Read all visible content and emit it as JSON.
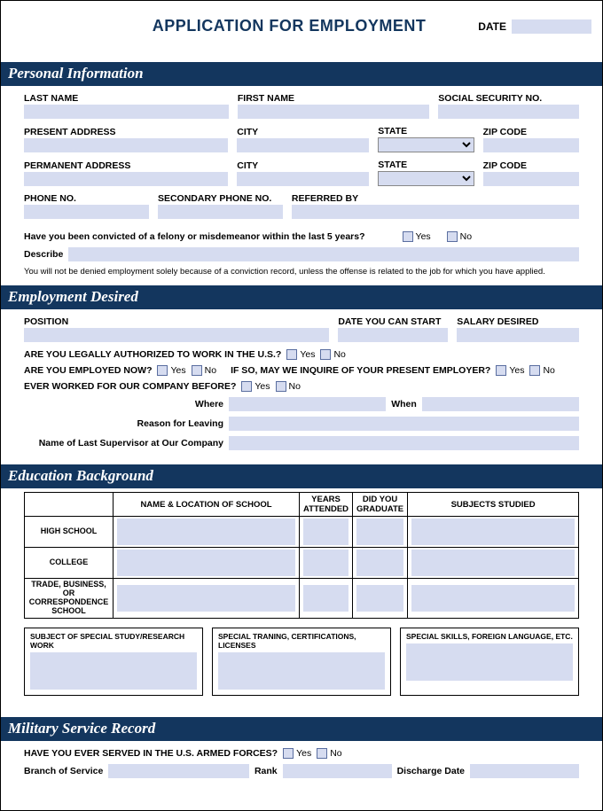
{
  "header": {
    "title": "APPLICATION FOR EMPLOYMENT",
    "date_label": "DATE"
  },
  "sections": {
    "personal": {
      "title": "Personal Information",
      "last_name": "LAST NAME",
      "first_name": "FIRST NAME",
      "ssn": "SOCIAL SECURITY NO.",
      "present_address": "PRESENT ADDRESS",
      "city": "CITY",
      "state": "STATE",
      "zip": "ZIP CODE",
      "permanent_address": "PERMANENT ADDRESS",
      "phone": "PHONE NO.",
      "secondary_phone": "SECONDARY PHONE NO.",
      "referred_by": "REFERRED BY",
      "felony_q": "Have you been convicted of a felony or misdemeanor within the last 5 years?",
      "yes": "Yes",
      "no": "No",
      "describe": "Describe",
      "disclaimer": "You will not be denied employment solely because of a conviction record, unless the offense is related to the job for which you have applied."
    },
    "employment": {
      "title": "Employment Desired",
      "position": "POSITION",
      "start_date": "DATE YOU CAN START",
      "salary": "SALARY DESIRED",
      "authorized_q": "ARE YOU LEGALLY AUTHORIZED TO WORK IN THE U.S.?",
      "employed_q": "ARE YOU EMPLOYED NOW?",
      "inquire_q": "IF SO, MAY WE INQUIRE OF YOUR PRESENT EMPLOYER?",
      "worked_before_q": "EVER WORKED FOR OUR COMPANY BEFORE?",
      "where": "Where",
      "when": "When",
      "reason": "Reason for Leaving",
      "supervisor": "Name of Last Supervisor at Our Company",
      "yes": "Yes",
      "no": "No"
    },
    "education": {
      "title": "Education Background",
      "col_school": "NAME & LOCATION OF SCHOOL",
      "col_years": "YEARS ATTENDED",
      "col_graduate": "DID YOU GRADUATE",
      "col_subjects": "SUBJECTS STUDIED",
      "row_hs": "HIGH SCHOOL",
      "row_college": "COLLEGE",
      "row_trade": "TRADE, BUSINESS, OR CORRESPONDENCE SCHOOL",
      "box_research": "SUBJECT OF SPECIAL STUDY/RESEARCH WORK",
      "box_training": "SPECIAL TRANING, CERTIFICATIONS, LICENSES",
      "box_skills": "SPECIAL SKILLS, FOREIGN LANGUAGE, ETC."
    },
    "military": {
      "title": "Military Service Record",
      "served_q": "HAVE YOU EVER SERVED IN THE U.S. ARMED FORCES?",
      "yes": "Yes",
      "no": "No",
      "branch": "Branch of Service",
      "rank": "Rank",
      "discharge": "Discharge Date"
    }
  }
}
